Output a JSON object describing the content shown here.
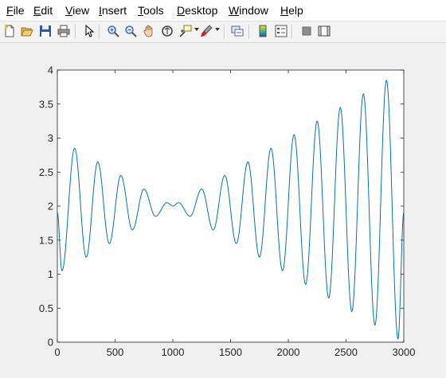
{
  "menu": {
    "items": [
      {
        "id": "file",
        "acc": "F",
        "rest": "ile"
      },
      {
        "id": "edit",
        "acc": "E",
        "rest": "dit"
      },
      {
        "id": "view",
        "acc": "V",
        "rest": "iew"
      },
      {
        "id": "insert",
        "acc": "I",
        "rest": "nsert"
      },
      {
        "id": "tools",
        "acc": "T",
        "rest": "ools"
      },
      {
        "id": "desktop",
        "acc": "D",
        "rest": "esktop"
      },
      {
        "id": "window",
        "acc": "W",
        "rest": "indow"
      },
      {
        "id": "help",
        "acc": "H",
        "rest": "elp"
      }
    ]
  },
  "toolbar": {
    "buttons": [
      {
        "id": "new-figure",
        "icon": "new-document-icon"
      },
      {
        "id": "open-file",
        "icon": "folder-open-icon"
      },
      {
        "id": "save-figure",
        "icon": "floppy-disk-icon"
      },
      {
        "id": "print-figure",
        "icon": "printer-icon"
      },
      {
        "id": "edit-plot",
        "icon": "arrow-cursor-icon"
      },
      {
        "id": "zoom-in",
        "icon": "zoom-in-icon"
      },
      {
        "id": "zoom-out",
        "icon": "zoom-out-icon"
      },
      {
        "id": "pan",
        "icon": "hand-icon"
      },
      {
        "id": "rotate-3d",
        "icon": "rotate-3d-icon"
      },
      {
        "id": "data-cursor",
        "icon": "data-cursor-icon"
      },
      {
        "id": "brush",
        "icon": "brush-icon"
      },
      {
        "id": "link-plot",
        "icon": "link-plot-icon"
      },
      {
        "id": "insert-colorbar",
        "icon": "colorbar-icon"
      },
      {
        "id": "insert-legend",
        "icon": "legend-icon"
      },
      {
        "id": "hide-plot-tools",
        "icon": "hide-plot-tools-icon"
      },
      {
        "id": "show-plot-tools",
        "icon": "show-plot-tools-icon"
      }
    ],
    "colors": {
      "zoom": "#3a6fb5",
      "brush": "#d02020",
      "colorbar_top": "#ffd700",
      "colorbar_bottom": "#2050c0"
    }
  },
  "chart_data": {
    "type": "line",
    "title": "",
    "xlabel": "",
    "ylabel": "",
    "xlim": [
      0,
      3000
    ],
    "ylim": [
      0,
      4
    ],
    "xticks": [
      0,
      500,
      1000,
      1500,
      2000,
      2500,
      3000
    ],
    "yticks": [
      0,
      0.5,
      1,
      1.5,
      2,
      2.5,
      3,
      3.5,
      4
    ],
    "xtick_labels": [
      "0",
      "500",
      "1000",
      "1500",
      "2000",
      "2500",
      "3000"
    ],
    "ytick_labels": [
      "0",
      "0.5",
      "1",
      "1.5",
      "2",
      "2.5",
      "3",
      "3.5",
      "4"
    ],
    "grid": false,
    "line_color": "#0072bd",
    "series": [
      {
        "x": [
          0,
          40,
          150,
          250,
          350,
          450,
          550,
          650,
          750,
          850,
          950,
          1000,
          1050,
          1150,
          1250,
          1350,
          1450,
          1550,
          1650,
          1750,
          1850,
          1950,
          2050,
          2150,
          2250,
          2350,
          2450,
          2550,
          2650,
          2750,
          2850,
          2950,
          3000
        ],
        "y": [
          1.9,
          1.05,
          2.85,
          1.25,
          2.65,
          1.45,
          2.45,
          1.65,
          2.25,
          1.85,
          2.05,
          2.0,
          2.05,
          1.85,
          2.25,
          1.65,
          2.45,
          1.45,
          2.65,
          1.25,
          2.85,
          1.05,
          3.05,
          0.85,
          3.25,
          0.65,
          3.45,
          0.45,
          3.65,
          0.25,
          3.85,
          0.05,
          1.9
        ]
      }
    ]
  }
}
